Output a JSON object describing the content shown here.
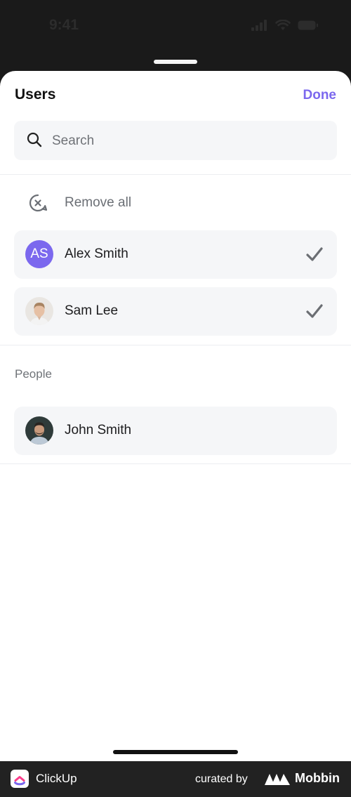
{
  "status_bar": {
    "time": "9:41"
  },
  "sheet": {
    "title": "Users",
    "done_label": "Done"
  },
  "search": {
    "placeholder": "Search"
  },
  "remove_all": {
    "label": "Remove all",
    "icon": "remove-circle-icon"
  },
  "selected_users": [
    {
      "name": "Alex Smith",
      "initials": "AS",
      "avatar_color": "#7b68ee",
      "checked": true
    },
    {
      "name": "Sam Lee",
      "avatar": "photo",
      "checked": true
    }
  ],
  "people": {
    "section_label": "People",
    "items": [
      {
        "name": "John Smith",
        "avatar": "photo"
      }
    ]
  },
  "footer": {
    "app_name": "ClickUp",
    "curated_by": "curated by",
    "brand": "Mobbin"
  },
  "colors": {
    "accent": "#7b68ee",
    "row_bg": "#f5f6f8"
  }
}
